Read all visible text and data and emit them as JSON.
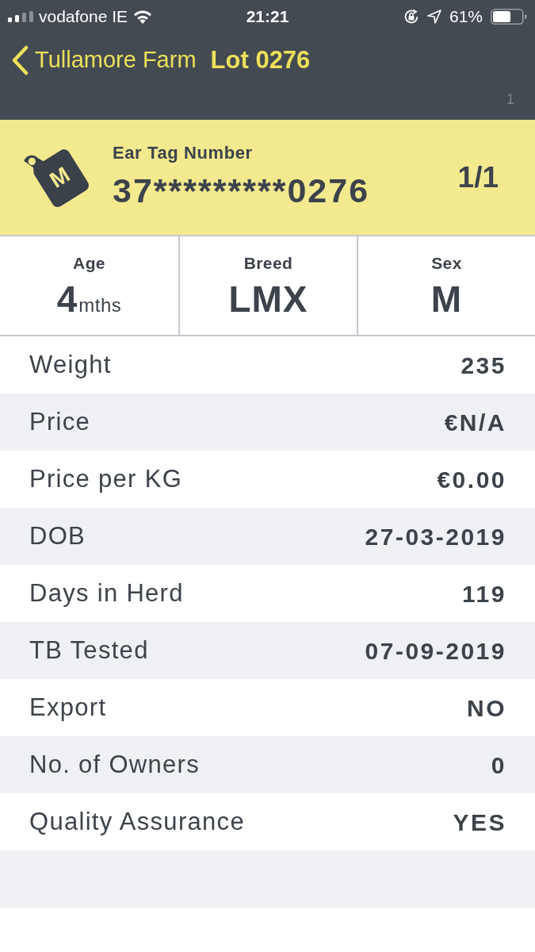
{
  "status_bar": {
    "carrier": "vodafone IE",
    "time": "21:21",
    "battery": "61%"
  },
  "header": {
    "back_label": "Tullamore Farm",
    "title": "Lot 0276",
    "corner_number": "1"
  },
  "tag": {
    "letter": "M",
    "label": "Ear Tag Number",
    "number": "37*********0276",
    "count": "1/1"
  },
  "stats": [
    {
      "label": "Age",
      "value": "4",
      "unit": "mths"
    },
    {
      "label": "Breed",
      "value": "LMX"
    },
    {
      "label": "Sex",
      "value": "M"
    }
  ],
  "rows": [
    {
      "label": "Weight",
      "value": "235"
    },
    {
      "label": "Price",
      "value": "€N/A"
    },
    {
      "label": "Price per KG",
      "value": "€0.00"
    },
    {
      "label": "DOB",
      "value": "27-03-2019"
    },
    {
      "label": "Days in Herd",
      "value": "119"
    },
    {
      "label": "TB Tested",
      "value": "07-09-2019"
    },
    {
      "label": "Export",
      "value": "NO"
    },
    {
      "label": "No. of Owners",
      "value": "0"
    },
    {
      "label": "Quality Assurance",
      "value": "YES"
    }
  ]
}
